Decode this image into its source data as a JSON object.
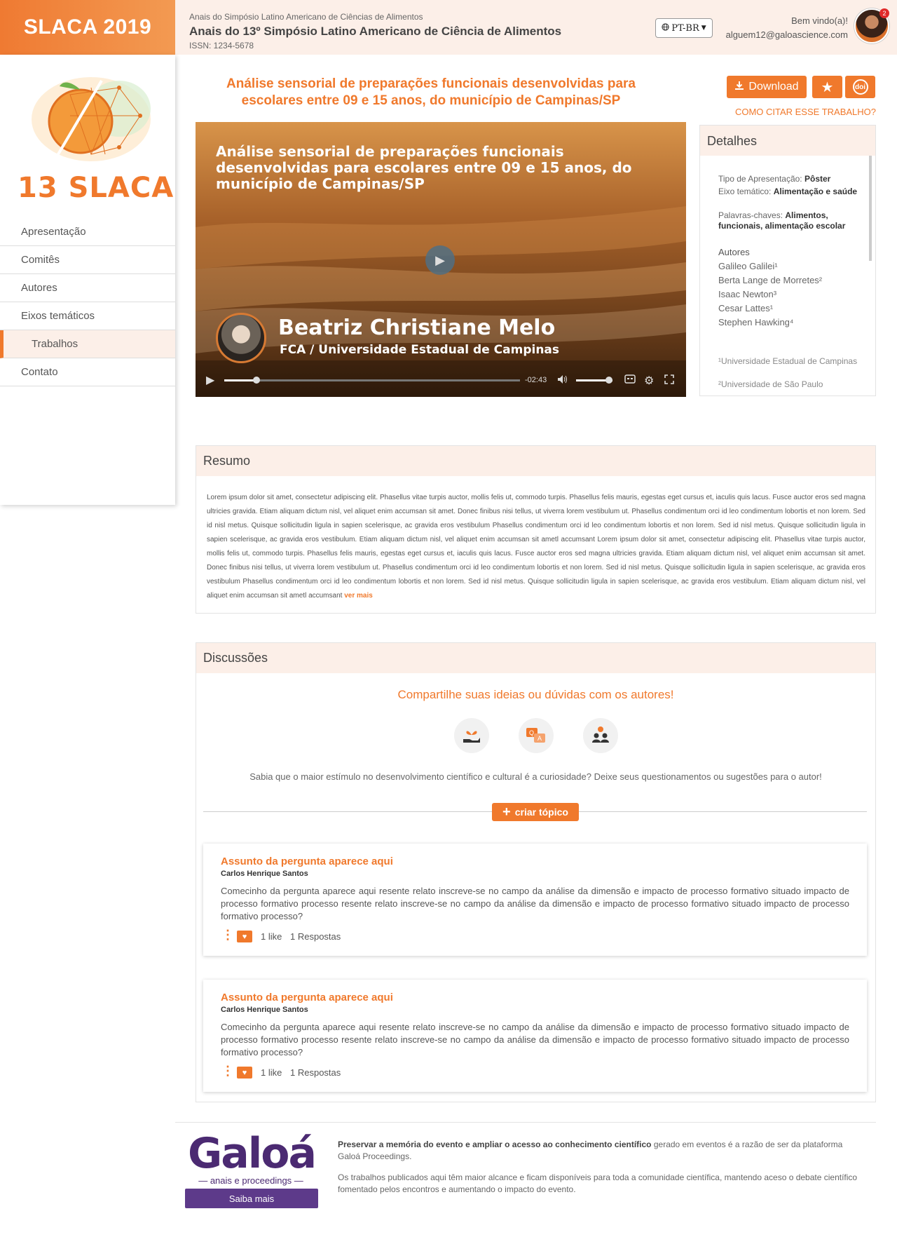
{
  "header": {
    "brand": "SLACA 2019",
    "crumb": "Anais do Simpósio Latino Americano de Ciências de Alimentos",
    "title": "Anais do 13º Simpósio Latino Americano de Ciência de Alimentos",
    "issn": "ISSN: 1234-5678",
    "language": "PT-BR",
    "welcome": "Bem vindo(a)!",
    "email": "alguem12@galoascience.com",
    "notifications": "2"
  },
  "sidebar": {
    "logo_text": "13 SLACA",
    "items": [
      {
        "label": "Apresentação"
      },
      {
        "label": "Comitês"
      },
      {
        "label": "Autores"
      },
      {
        "label": "Eixos temáticos"
      },
      {
        "label": "Trabalhos"
      },
      {
        "label": "Contato"
      }
    ]
  },
  "article": {
    "title": "Análise sensorial de preparações funcionais desenvolvidas para escolares entre 09 e 15 anos, do município de Campinas/SP",
    "download_label": "Download",
    "doi_label": "doi",
    "cite_label": "COMO CITAR ESSE TRABALHO?"
  },
  "video": {
    "title": "Análise sensorial de preparações funcionais desenvolvidas para escolares entre 09 e 15 anos, do município de Campinas/SP",
    "speaker": "Beatriz Christiane Melo",
    "affiliation": "FCA / Universidade Estadual de Campinas",
    "time_remaining": "-02:43",
    "progress": 0.11,
    "volume": 0.9
  },
  "details": {
    "heading": "Detalhes",
    "type_label": "Tipo de Apresentação:",
    "type_value": "Pôster",
    "axis_label": "Eixo temático:",
    "axis_value": "Alimentação e saúde",
    "keywords_label": "Palavras-chaves:",
    "keywords_value": "Alimentos, funcionais, alimentação escolar",
    "authors_heading": "Autores",
    "authors": [
      "Galileo Galilei¹",
      "Berta Lange de Morretes²",
      "Isaac Newton³",
      "Cesar Lattes¹",
      "Stephen Hawking⁴"
    ],
    "institutions": [
      "¹Universidade Estadual de Campinas",
      "²Universidade de São Paulo"
    ]
  },
  "resumo": {
    "heading": "Resumo",
    "text": "Lorem ipsum dolor sit amet, consectetur adipiscing elit. Phasellus vitae turpis auctor, mollis felis ut, commodo turpis. Phasellus felis mauris, egestas eget cursus et, iaculis quis lacus. Fusce auctor eros sed magna ultricies gravida. Etiam aliquam dictum nisl, vel aliquet enim accumsan sit amet. Donec finibus nisi tellus, ut viverra lorem vestibulum ut. Phasellus condimentum orci id leo condimentum lobortis et non lorem. Sed id nisl metus. Quisque sollicitudin ligula in sapien scelerisque, ac gravida eros vestibulum Phasellus condimentum orci id leo condimentum lobortis et non lorem. Sed id nisl metus. Quisque sollicitudin ligula in sapien scelerisque, ac gravida eros vestibulum. Etiam aliquam dictum nisl, vel aliquet enim accumsan sit ametl accumsant Lorem ipsum dolor sit amet, consectetur adipiscing elit. Phasellus vitae turpis auctor, mollis felis ut, commodo turpis. Phasellus felis mauris, egestas eget cursus et, iaculis quis lacus. Fusce auctor eros sed magna ultricies gravida. Etiam aliquam dictum nisl, vel aliquet enim accumsan sit amet. Donec finibus nisi tellus, ut viverra lorem vestibulum ut. Phasellus condimentum orci id leo condimentum lobortis et non lorem. Sed id nisl metus. Quisque sollicitudin ligula in sapien scelerisque, ac gravida eros vestibulum Phasellus condimentum orci id leo condimentum lobortis et non lorem. Sed id nisl metus. Quisque sollicitudin ligula in sapien scelerisque, ac gravida eros vestibulum. Etiam aliquam dictum nisl, vel aliquet enim accumsan sit ametl accumsant",
    "more": "ver mais"
  },
  "discussions": {
    "heading": "Discussões",
    "lead": "Compartilhe suas ideias ou dúvidas com os autores!",
    "sub": "Sabia que o maior estímulo no desenvolvimento científico e cultural é a curiosidade? Deixe seus questionamentos ou sugestões para o autor!",
    "create_topic": "criar tópico",
    "topics": [
      {
        "title": "Assunto da pergunta aparece aqui",
        "author": "Carlos Henrique Santos",
        "body": "Comecinho da pergunta aparece aqui resente relato inscreve-se no campo da análise da dimensão e impacto de processo formativo situado impacto de processo formativo processo resente relato inscreve-se no campo da análise da dimensão e impacto de processo formativo situado impacto de processo formativo processo?",
        "likes": "1 like",
        "replies": "1 Respostas"
      },
      {
        "title": "Assunto da pergunta aparece aqui",
        "author": "Carlos Henrique Santos",
        "body": "Comecinho da pergunta aparece aqui resente relato inscreve-se no campo da análise da dimensão e impacto de processo formativo situado impacto de processo formativo processo resente relato inscreve-se no campo da análise da dimensão e impacto de processo formativo situado impacto de processo formativo processo?",
        "likes": "1 like",
        "replies": "1 Respostas"
      }
    ]
  },
  "footer": {
    "brand": "Galoá",
    "brand_sub": "— anais e proceedings —",
    "saiba": "Saiba mais",
    "p1_bold": "Preservar a memória do evento e ampliar o acesso ao conhecimento científico",
    "p1_rest": " gerado em eventos é a razão de ser da plataforma Galoá Proceedings.",
    "p2": "Os trabalhos publicados aqui têm maior alcance e ficam disponíveis para toda a comunidade científica, mantendo aceso o debate científico fomentado pelos encontros e aumentando o impacto do evento."
  },
  "colors": {
    "accent": "#f0792c",
    "header_bg": "#fcefe8",
    "galoa": "#4b2a72"
  },
  "icons": [
    "globe-icon",
    "download-icon",
    "star-icon",
    "doi-icon",
    "play-icon",
    "volume-icon",
    "captions-icon",
    "gear-icon",
    "fullscreen-icon",
    "plant-hand-icon",
    "qa-icon",
    "people-icon",
    "plus-icon",
    "more-vert-icon",
    "heart-icon"
  ]
}
